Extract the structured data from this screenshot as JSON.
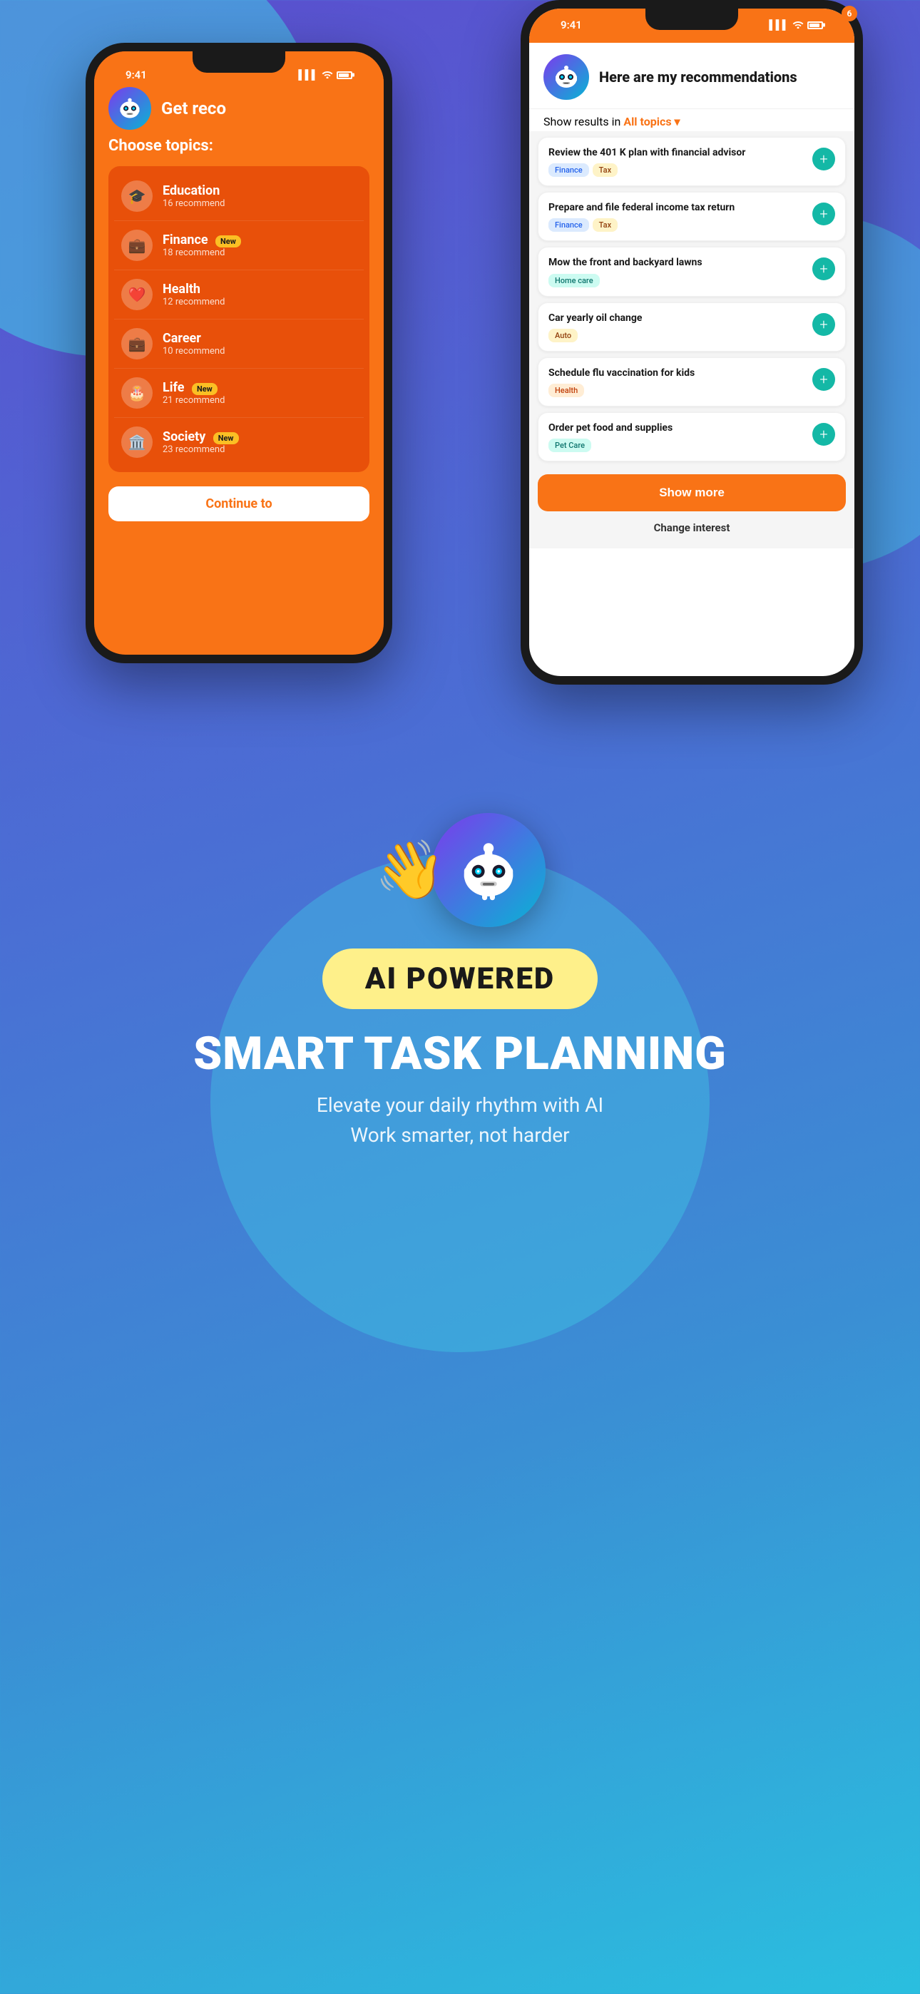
{
  "background": {
    "color_start": "#5b4fcf",
    "color_end": "#2abfdf"
  },
  "phone_back": {
    "status_time": "9:41",
    "header_text": "Get reco",
    "choose_topics_label": "Choose topics:",
    "topics": [
      {
        "id": "education",
        "icon": "🎓",
        "name": "Education",
        "count": "16 recommend",
        "is_new": false
      },
      {
        "id": "finance",
        "icon": "💼",
        "name": "Finance",
        "count": "18 recommend",
        "is_new": true
      },
      {
        "id": "health",
        "icon": "❤️",
        "name": "Health",
        "count": "12 recommend",
        "is_new": false
      },
      {
        "id": "career",
        "icon": "💼",
        "name": "Career",
        "count": "10 recommend",
        "is_new": false
      },
      {
        "id": "life",
        "icon": "🎂",
        "name": "Life",
        "count": "21 recommend",
        "is_new": true
      },
      {
        "id": "society",
        "icon": "🏛️",
        "name": "Society",
        "count": "23 recommend",
        "is_new": true
      }
    ],
    "continue_btn": "Continue to"
  },
  "phone_front": {
    "status_time": "9:41",
    "notification_count": "6",
    "header_title": "Here are my recommendations",
    "show_results_label": "Show results in",
    "show_results_topic": "All topics ▾",
    "recommendations": [
      {
        "id": 1,
        "title": "Review the 401 K plan with financial advisor",
        "tags": [
          {
            "label": "Finance",
            "style": "blue"
          },
          {
            "label": "Tax",
            "style": "yellow"
          }
        ]
      },
      {
        "id": 2,
        "title": "Prepare and file federal income tax return",
        "tags": [
          {
            "label": "Finance",
            "style": "blue"
          },
          {
            "label": "Tax",
            "style": "yellow"
          }
        ]
      },
      {
        "id": 3,
        "title": "Mow the front and backyard lawns",
        "tags": [
          {
            "label": "Home care",
            "style": "teal"
          }
        ]
      },
      {
        "id": 4,
        "title": "Car yearly oil change",
        "tags": [
          {
            "label": "Auto",
            "style": "yellow"
          }
        ]
      },
      {
        "id": 5,
        "title": "Schedule flu vaccination for kids",
        "tags": [
          {
            "label": "Health",
            "style": "orange"
          }
        ]
      },
      {
        "id": 6,
        "title": "Order pet food and supplies",
        "tags": [
          {
            "label": "Pet Care",
            "style": "teal"
          }
        ]
      }
    ],
    "show_more_btn": "Show more",
    "change_interest_btn": "Change interest"
  },
  "bottom_section": {
    "ai_powered_label": "AI POWERED",
    "main_headline": "SMART TASK PLANNING",
    "sub_line1": "Elevate your daily rhythm with AI",
    "sub_line2": "Work smarter, not harder"
  }
}
